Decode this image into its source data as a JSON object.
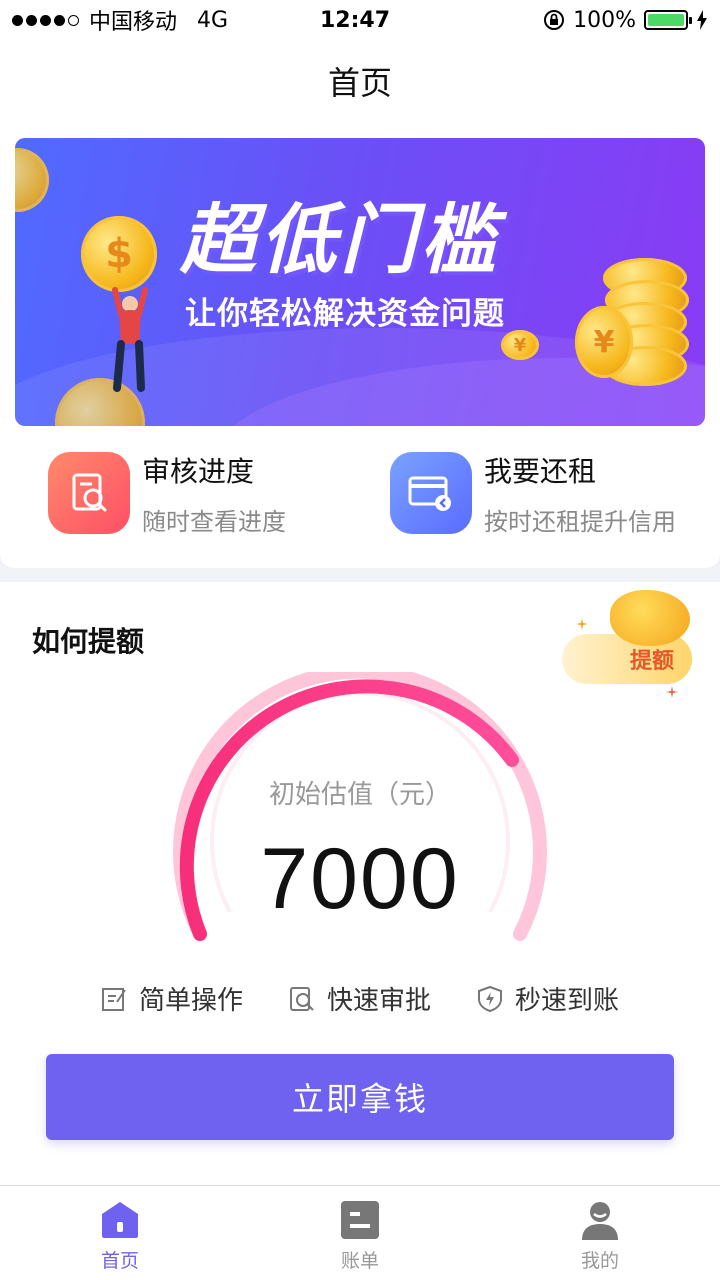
{
  "status_bar": {
    "carrier": "中国移动",
    "network": "4G",
    "time": "12:47",
    "battery": "100%"
  },
  "nav": {
    "title": "首页"
  },
  "banner": {
    "title": "超低门槛",
    "subtitle": "让你轻松解决资金问题"
  },
  "quick_links": [
    {
      "title": "审核进度",
      "subtitle": "随时查看进度",
      "icon": "review-search-icon"
    },
    {
      "title": "我要还租",
      "subtitle": "按时还租提升信用",
      "icon": "card-payment-icon"
    }
  ],
  "credit": {
    "section_title": "如何提额",
    "badge_label": "提额",
    "gauge_label": "初始估值（元）",
    "gauge_value": "7000",
    "features": [
      {
        "label": "简单操作",
        "icon": "edit-icon"
      },
      {
        "label": "快速审批",
        "icon": "search-review-icon"
      },
      {
        "label": "秒速到账",
        "icon": "lightning-shield-icon"
      }
    ],
    "cta_label": "立即拿钱"
  },
  "tabs": [
    {
      "label": "首页",
      "icon": "home-icon",
      "active": true
    },
    {
      "label": "账单",
      "icon": "bill-icon",
      "active": false
    },
    {
      "label": "我的",
      "icon": "user-icon",
      "active": false
    }
  ],
  "colors": {
    "accent": "#6f62f0",
    "gauge_start": "#f72f7a",
    "gauge_track": "#ffc6d9",
    "battery_green": "#4cd964"
  }
}
